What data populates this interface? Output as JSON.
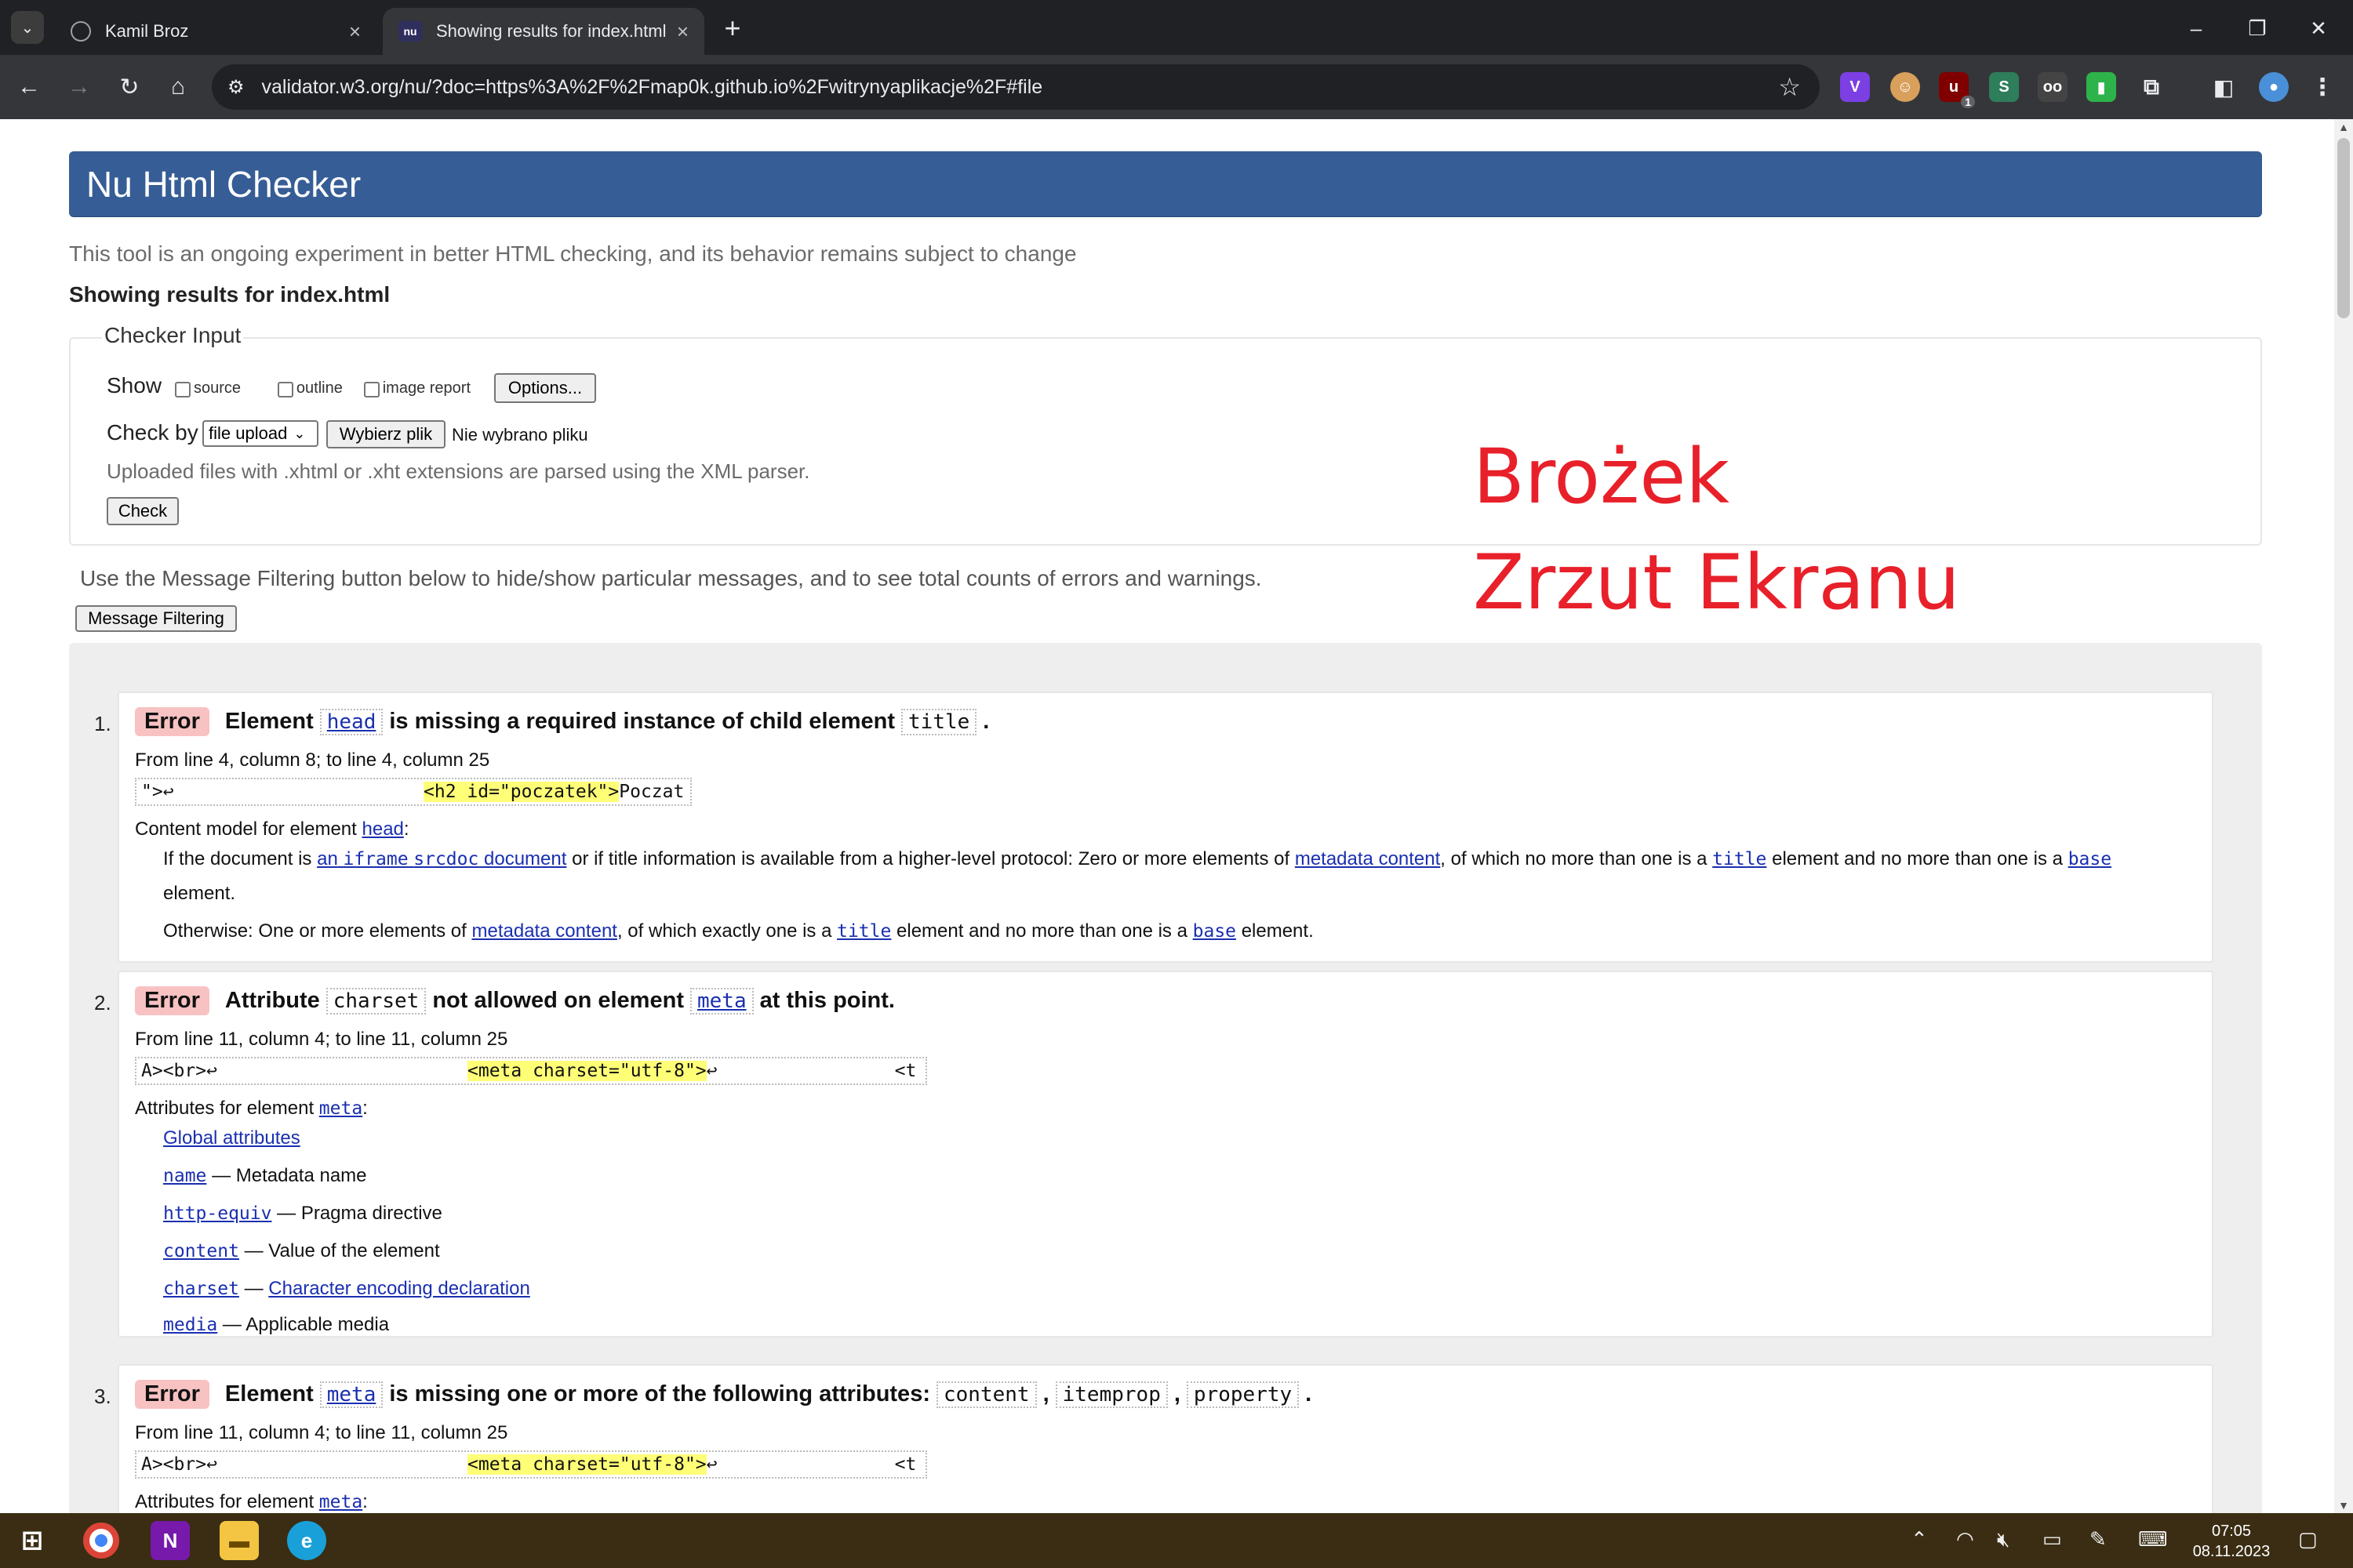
{
  "browser": {
    "tabs": [
      {
        "title": "Kamil Broz",
        "favicon": "globe-icon",
        "active": false
      },
      {
        "title": "Showing results for index.html",
        "favicon": "nu-icon",
        "active": true
      }
    ],
    "url": "validator.w3.org/nu/?doc=https%3A%2F%2Fmap0k.github.io%2Fwitrynyaplikacje%2F#file",
    "extensions": [
      "v-extension-icon",
      "avatar-extension-icon",
      "ublock-extension-icon",
      "s-extension-icon",
      "glasses-extension-icon",
      "green-extension-icon",
      "puzzle-icon"
    ],
    "ext_badge": "1"
  },
  "page": {
    "title": "Nu Html Checker",
    "intro": "This tool is an ongoing experiment in better HTML checking, and its behavior remains subject to change",
    "showing": "Showing results for index.html",
    "checker_input": {
      "legend": "Checker Input",
      "show_label": "Show",
      "options": [
        "source",
        "outline",
        "image report"
      ],
      "options_button": "Options...",
      "check_by_label": "Check by",
      "check_by_value": "file upload",
      "choose_file_button": "Wybierz plik",
      "no_file_text": "Nie wybrano pliku",
      "note": "Uploaded files with .xhtml or .xht extensions are parsed using the XML parser.",
      "check_button": "Check"
    },
    "filter_text": "Use the Message Filtering button below to hide/show particular messages, and to see total counts of errors and warnings.",
    "filter_button": "Message Filtering",
    "annotation_line1": "Brożek",
    "annotation_line2": "Zrzut Ekranu"
  },
  "messages": [
    {
      "number": "1.",
      "type": "Error",
      "head": [
        "Element",
        "head",
        "is missing a required instance of child element",
        "title",
        "."
      ],
      "location": "From line 4, column 8; to line 4, column 25",
      "extract_before": "\">↩",
      "extract_hl": "<h2 id=\"poczatek\">",
      "extract_after": "Poczat",
      "content_model_label": "Content model for element",
      "content_model_el": "head",
      "p1": [
        "If the document is",
        "an",
        "iframe",
        "srcdoc",
        "document",
        "or if title information is available from a higher-level protocol: Zero or more elements of",
        "metadata content",
        ", of which no more than one is a",
        "title",
        "element and no more than one is a",
        "base"
      ],
      "p1_end": "element.",
      "p2": [
        "Otherwise: One or more elements of",
        "metadata content",
        ", of which exactly one is a",
        "title",
        "element and no more than one is a",
        "base",
        "element."
      ]
    },
    {
      "number": "2.",
      "type": "Error",
      "head": [
        "Attribute",
        "charset",
        "not allowed on element",
        "meta",
        "at this point."
      ],
      "location": "From line 11, column 4; to line 11, column 25",
      "extract_before": "A><br>↩",
      "extract_hl": "<meta charset=\"utf-8\">",
      "extract_after": "↩",
      "extract_tail": "<t",
      "attrs_label": "Attributes for element",
      "attrs_el": "meta",
      "attrs": [
        {
          "name": "Global attributes",
          "desc": ""
        },
        {
          "name": "name",
          "desc": "— Metadata name"
        },
        {
          "name": "http-equiv",
          "desc": "— Pragma directive"
        },
        {
          "name": "content",
          "desc": "— Value of the element"
        },
        {
          "name": "charset",
          "desc": "—",
          "desc_link": "Character encoding declaration"
        },
        {
          "name": "media",
          "desc": "— Applicable media"
        }
      ]
    },
    {
      "number": "3.",
      "type": "Error",
      "head": [
        "Element",
        "meta",
        "is missing one or more of the following attributes:",
        "content",
        "itemprop",
        "property",
        "."
      ],
      "location": "From line 11, column 4; to line 11, column 25",
      "extract_before": "A><br>↩",
      "extract_hl": "<meta charset=\"utf-8\">",
      "extract_after": "↩",
      "extract_tail": "<t",
      "attrs_label": "Attributes for element",
      "attrs_el": "meta"
    }
  ],
  "taskbar": {
    "apps": [
      "windows-start-icon",
      "chrome-icon",
      "onenote-icon",
      "file-explorer-icon",
      "edge-icon"
    ],
    "time": "07:05",
    "date": "08.11.2023"
  }
}
